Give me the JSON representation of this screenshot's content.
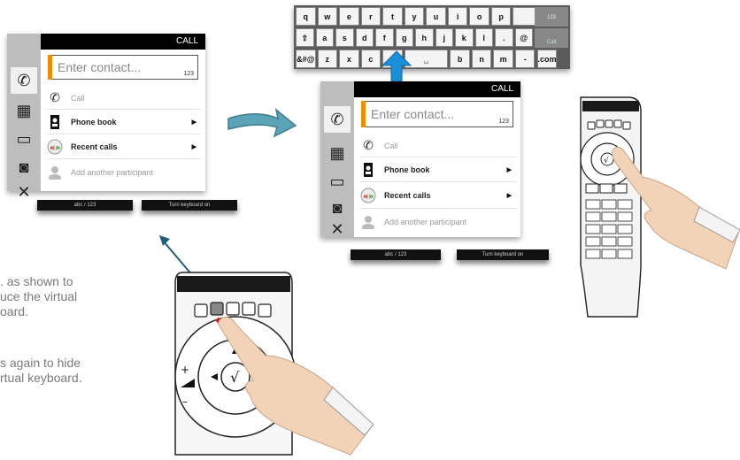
{
  "left_screen": {
    "header": "CALL",
    "input_placeholder": "Enter contact...",
    "input_mode": "123",
    "items": [
      {
        "label": "Call",
        "dim": true
      },
      {
        "label": "Phone book",
        "arrow": "▶"
      },
      {
        "label": "Recent calls",
        "arrow": "▶"
      },
      {
        "label": "Add another participant",
        "dim": true
      }
    ],
    "softkeys": [
      "abc / 123",
      "Turn keyboard on"
    ]
  },
  "right_screen": {
    "header": "CALL",
    "input_placeholder": "Enter contact...",
    "input_mode": "123",
    "items": [
      {
        "label": "Call",
        "dim": true
      },
      {
        "label": "Phone book",
        "arrow": "▶"
      },
      {
        "label": "Recent calls",
        "arrow": "▶"
      },
      {
        "label": "Add another participant",
        "dim": true
      }
    ],
    "softkeys": [
      "abc / 123",
      "Turn keyboard on"
    ]
  },
  "keyboard": {
    "row1": [
      "q",
      "w",
      "e",
      "r",
      "t",
      "y",
      "u",
      "i",
      "o",
      "p",
      "←"
    ],
    "row2": [
      "⇧",
      "a",
      "s",
      "d",
      "f",
      "g",
      "h",
      "j",
      "k",
      "l",
      ".",
      "@"
    ],
    "row3": [
      "&#@",
      "z",
      "x",
      "c",
      "v",
      "␣",
      "b",
      "n",
      "m",
      "-",
      ".com"
    ],
    "side_top": "123",
    "side_bottom": "Call"
  },
  "instructions": {
    "line1": ". as shown to",
    "line2": "uce the virtual",
    "line3": "oard.",
    "line4": "s again to hide",
    "line5": "rtual keyboard."
  },
  "colors": {
    "accent": "#f08c00",
    "arrow_blue": "#1b8fd8",
    "arrow_teal": "#3a8fa3"
  }
}
